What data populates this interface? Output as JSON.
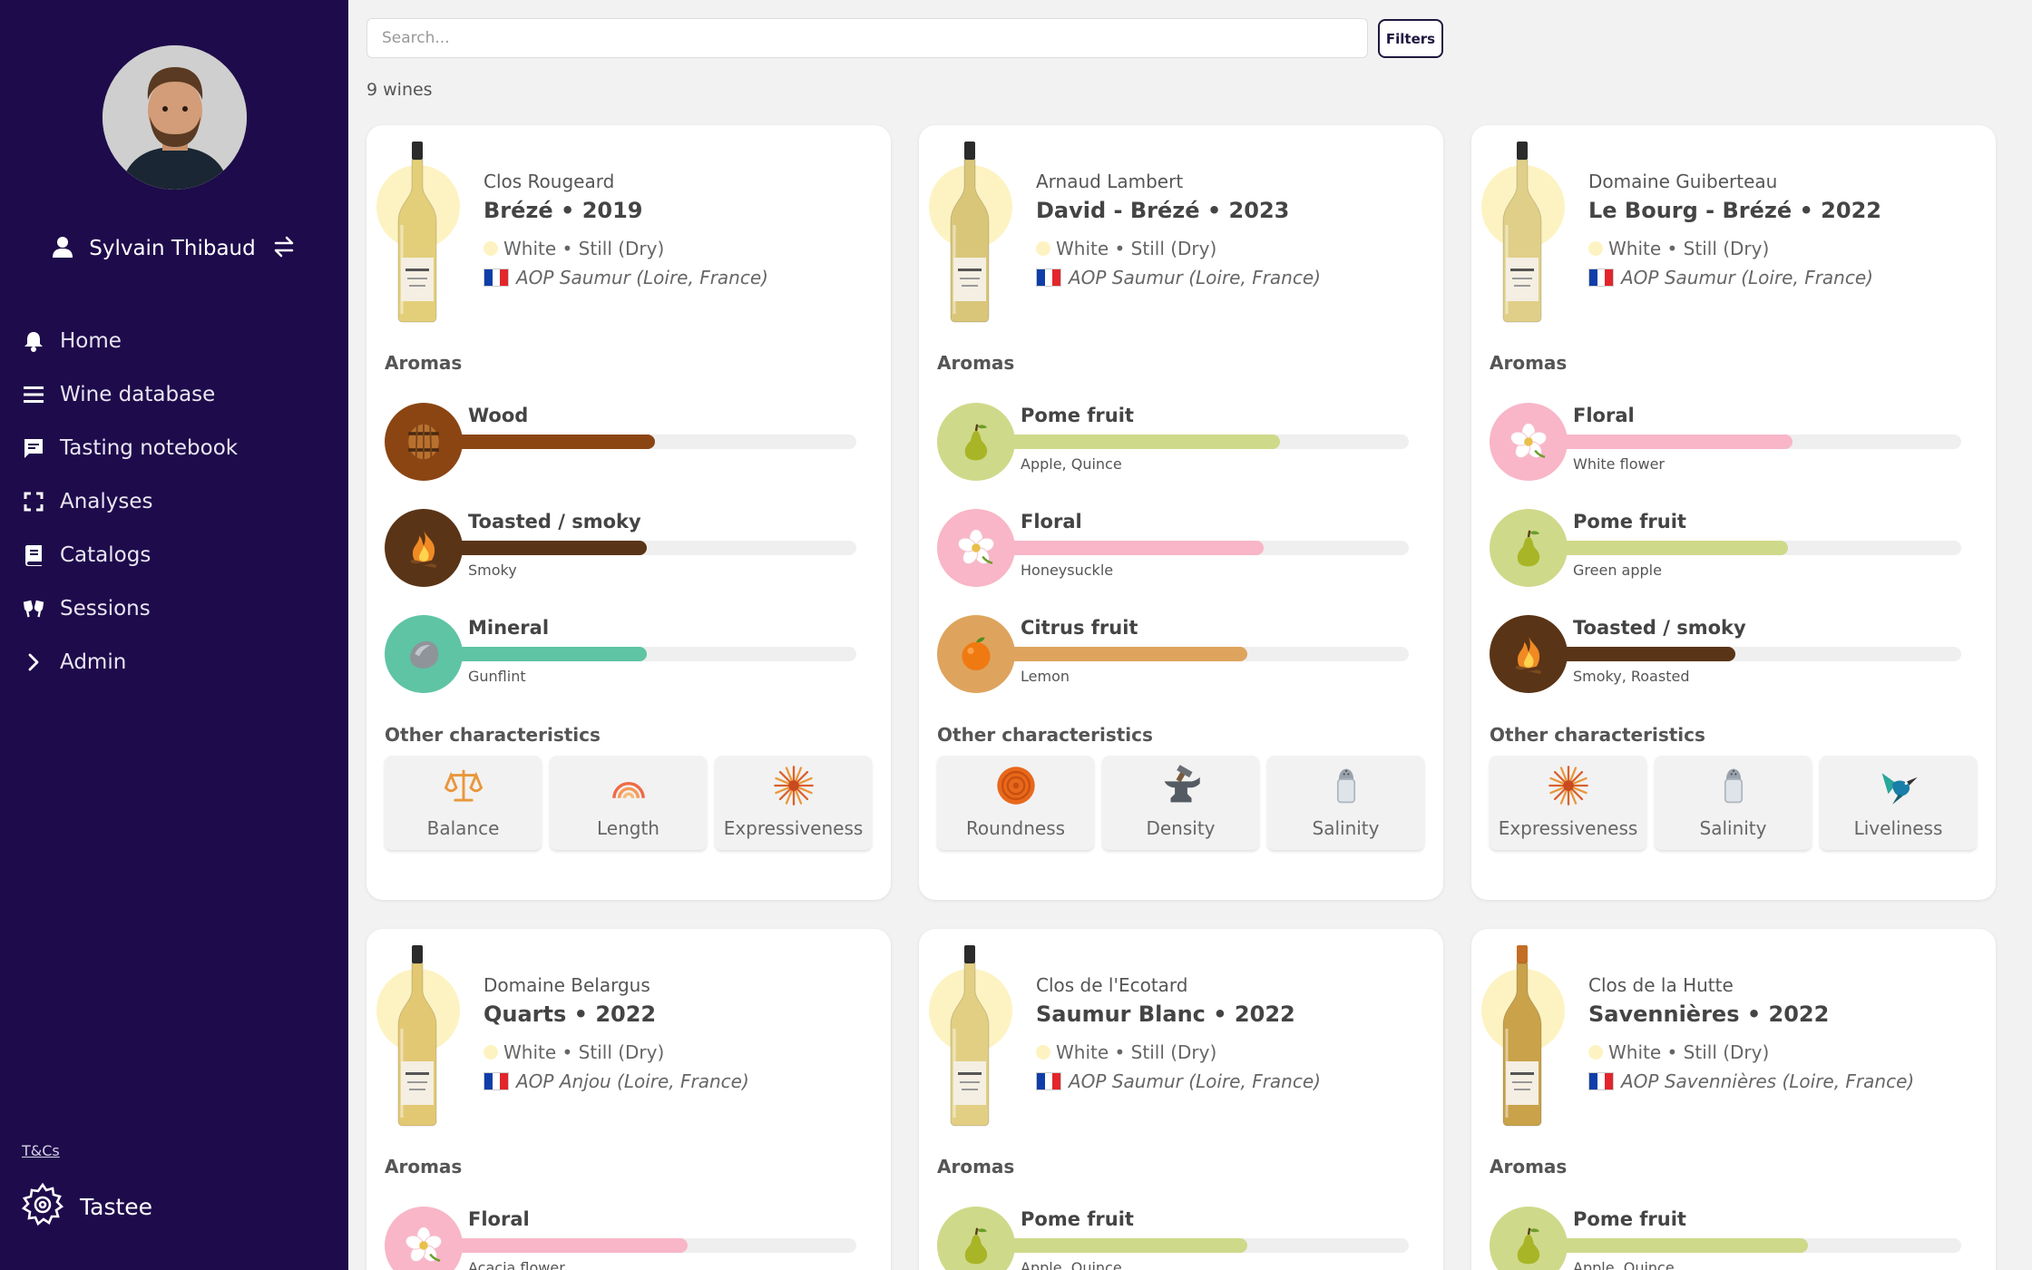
{
  "sidebar": {
    "user_name": "Sylvain Thibaud",
    "nav": [
      "Home",
      "Wine database",
      "Tasting notebook",
      "Analyses",
      "Catalogs",
      "Sessions",
      "Admin"
    ],
    "tcs": "T&Cs",
    "brand": "Tastee"
  },
  "search": {
    "placeholder": "Search..."
  },
  "filters_label": "Filters",
  "count": "9 wines",
  "labels": {
    "aromas": "Aromas",
    "other": "Other characteristics"
  },
  "colors": {
    "sidebar_bg": "#1e0b4b",
    "wood": "#8b4513",
    "smoky": "#5a3417",
    "mineral": "#5fc4a4",
    "pome": "#cfd98a",
    "floral": "#f8b6c8",
    "citrus": "#dea45e",
    "white_wine": "#fdf3c2"
  },
  "wines": [
    {
      "producer": "Clos Rougeard",
      "cuvee": "Brézé • 2019",
      "type": "White • Still (Dry)",
      "origin": "AOP Saumur (Loire, France)",
      "aromas": [
        {
          "name": "Wood",
          "detail": "",
          "level": 0.5,
          "color": "#8b4513",
          "icon": "barrel-icon"
        },
        {
          "name": "Toasted / smoky",
          "detail": "Smoky",
          "level": 0.48,
          "color": "#5a3417",
          "icon": "fire-icon"
        },
        {
          "name": "Mineral",
          "detail": "Gunflint",
          "level": 0.48,
          "color": "#5fc4a4",
          "icon": "stone-icon"
        }
      ],
      "characteristics": [
        {
          "label": "Balance",
          "icon": "scale-icon"
        },
        {
          "label": "Length",
          "icon": "arcs-icon"
        },
        {
          "label": "Expressiveness",
          "icon": "burst-icon"
        }
      ]
    },
    {
      "producer": "Arnaud Lambert",
      "cuvee": "David - Brézé • 2023",
      "type": "White • Still (Dry)",
      "origin": "AOP Saumur (Loire, France)",
      "aromas": [
        {
          "name": "Pome fruit",
          "detail": "Apple, Quince",
          "level": 0.68,
          "color": "#cfd98a",
          "icon": "pear-icon"
        },
        {
          "name": "Floral",
          "detail": "Honeysuckle",
          "level": 0.64,
          "color": "#f8b6c8",
          "icon": "flower-icon"
        },
        {
          "name": "Citrus fruit",
          "detail": "Lemon",
          "level": 0.6,
          "color": "#dea45e",
          "icon": "orange-icon"
        }
      ],
      "characteristics": [
        {
          "label": "Roundness",
          "icon": "rings-icon"
        },
        {
          "label": "Density",
          "icon": "anvil-icon"
        },
        {
          "label": "Salinity",
          "icon": "salt-shaker-icon"
        }
      ]
    },
    {
      "producer": "Domaine Guiberteau",
      "cuvee": "Le Bourg - Brézé • 2022",
      "type": "White • Still (Dry)",
      "origin": "AOP Saumur (Loire, France)",
      "aromas": [
        {
          "name": "Floral",
          "detail": "White flower",
          "level": 0.58,
          "color": "#f8b6c8",
          "icon": "flower-icon"
        },
        {
          "name": "Pome fruit",
          "detail": "Green apple",
          "level": 0.57,
          "color": "#cfd98a",
          "icon": "pear-icon"
        },
        {
          "name": "Toasted / smoky",
          "detail": "Smoky, Roasted",
          "level": 0.44,
          "color": "#5a3417",
          "icon": "fire-icon"
        }
      ],
      "characteristics": [
        {
          "label": "Expressiveness",
          "icon": "burst-icon"
        },
        {
          "label": "Salinity",
          "icon": "salt-shaker-icon"
        },
        {
          "label": "Liveliness",
          "icon": "hummingbird-icon"
        }
      ]
    },
    {
      "producer": "Domaine Belargus",
      "cuvee": "Quarts • 2022",
      "type": "White • Still (Dry)",
      "origin": "AOP Anjou (Loire, France)",
      "aromas": [
        {
          "name": "Floral",
          "detail": "Acacia flower",
          "level": 0.58,
          "color": "#f8b6c8",
          "icon": "flower-icon"
        }
      ],
      "characteristics": []
    },
    {
      "producer": "Clos de l'Ecotard",
      "cuvee": "Saumur Blanc • 2022",
      "type": "White • Still (Dry)",
      "origin": "AOP Saumur (Loire, France)",
      "aromas": [
        {
          "name": "Pome fruit",
          "detail": "Apple, Quince",
          "level": 0.6,
          "color": "#cfd98a",
          "icon": "pear-icon"
        }
      ],
      "characteristics": []
    },
    {
      "producer": "Clos de la Hutte",
      "cuvee": "Savennières • 2022",
      "type": "White • Still (Dry)",
      "origin": "AOP Savennières (Loire, France)",
      "aromas": [
        {
          "name": "Pome fruit",
          "detail": "Apple, Quince",
          "level": 0.62,
          "color": "#cfd98a",
          "icon": "pear-icon"
        }
      ],
      "characteristics": []
    }
  ]
}
